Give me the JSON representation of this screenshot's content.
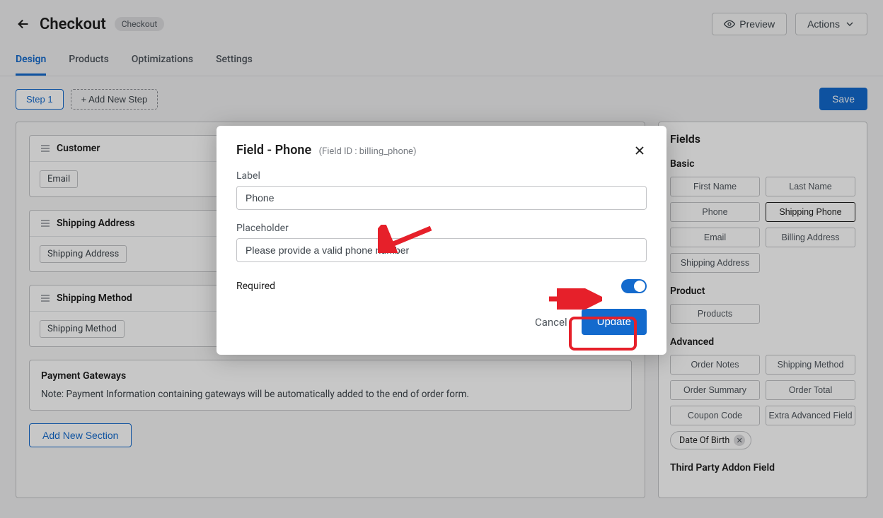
{
  "header": {
    "title": "Checkout",
    "badge": "Checkout",
    "preview": "Preview",
    "actions": "Actions"
  },
  "tabs": {
    "design": "Design",
    "products": "Products",
    "optimizations": "Optimizations",
    "settings": "Settings"
  },
  "steps": {
    "step1": "Step 1",
    "add": "+ Add New Step",
    "save": "Save"
  },
  "builder": {
    "sections": [
      {
        "title": "Customer",
        "chips": [
          "Email"
        ]
      },
      {
        "title": "Shipping Address",
        "chips": [
          "Shipping Address"
        ]
      },
      {
        "title": "Shipping Method",
        "chips": [
          "Shipping Method"
        ]
      }
    ],
    "payment_title": "Payment Gateways",
    "payment_note": "Note: Payment Information containing gateways will be automatically added to the end of order form.",
    "add_section": "Add New Section"
  },
  "sidebar": {
    "title": "Fields",
    "basic": {
      "heading": "Basic",
      "items": [
        "First Name",
        "Last Name",
        "Phone",
        "Shipping Phone",
        "Email",
        "Billing Address",
        "Shipping Address"
      ]
    },
    "product": {
      "heading": "Product",
      "items": [
        "Products"
      ]
    },
    "advanced": {
      "heading": "Advanced",
      "items": [
        "Order Notes",
        "Shipping Method",
        "Order Summary",
        "Order Total",
        "Coupon Code",
        "Extra Advanced Field"
      ],
      "dob": "Date Of Birth"
    },
    "third": {
      "heading": "Third Party Addon Field"
    }
  },
  "modal": {
    "title_prefix": "Field - ",
    "title_field": "Phone",
    "field_id_label": "(Field ID : billing_phone)",
    "label_label": "Label",
    "label_value": "Phone",
    "placeholder_label": "Placeholder",
    "placeholder_value": "Please provide a valid phone number",
    "required_label": "Required",
    "cancel": "Cancel",
    "update": "Update"
  }
}
